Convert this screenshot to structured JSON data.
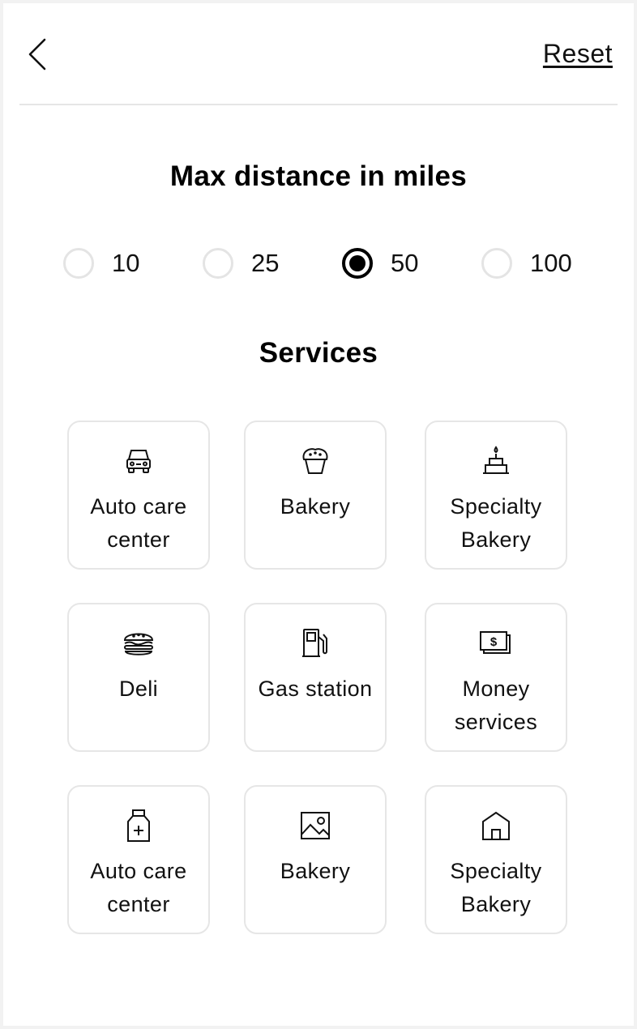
{
  "header": {
    "back_icon": "chevron-left-icon",
    "reset_label": "Reset"
  },
  "distance": {
    "title": "Max distance in miles",
    "options": [
      "10",
      "25",
      "50",
      "100"
    ],
    "selected": "50"
  },
  "services": {
    "title": "Services",
    "tiles": [
      {
        "label": "Auto care center",
        "icon": "car-icon"
      },
      {
        "label": "Bakery",
        "icon": "muffin-icon"
      },
      {
        "label": "Specialty Bakery",
        "icon": "cake-icon"
      },
      {
        "label": "Deli",
        "icon": "burger-icon"
      },
      {
        "label": "Gas station",
        "icon": "gas-pump-icon"
      },
      {
        "label": "Money services",
        "icon": "money-icon"
      },
      {
        "label": "Auto care center",
        "icon": "medicine-bottle-icon"
      },
      {
        "label": "Bakery",
        "icon": "photo-icon"
      },
      {
        "label": "Specialty Bakery",
        "icon": "house-icon"
      }
    ]
  },
  "colors": {
    "text": "#000000",
    "border": "#e6e6e6",
    "background": "#ffffff"
  }
}
